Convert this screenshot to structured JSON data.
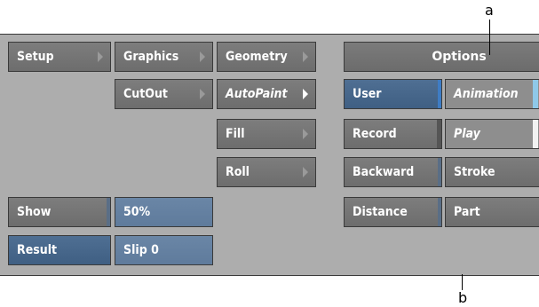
{
  "panel": {
    "setup": "Setup",
    "graphics": "Graphics",
    "geometry": "Geometry",
    "cutout": "CutOut",
    "autopaint": "AutoPaint",
    "fill": "Fill",
    "roll": "Roll",
    "show": "Show",
    "zoom": "50%",
    "result": "Result",
    "slip": "Slip 0"
  },
  "options": {
    "header": "Options",
    "user": "User",
    "animation": "Animation",
    "record": "Record",
    "play": "Play",
    "backward": "Backward",
    "stroke": "Stroke",
    "distance": "Distance",
    "part": "Part"
  },
  "callouts": {
    "a": "a",
    "b": "b"
  },
  "colors": {
    "panel_bg": "#adadad",
    "button_gray": "#6f6f6f",
    "button_blue": "#4a6a8e",
    "accent_cyan": "#8fc8e8"
  }
}
